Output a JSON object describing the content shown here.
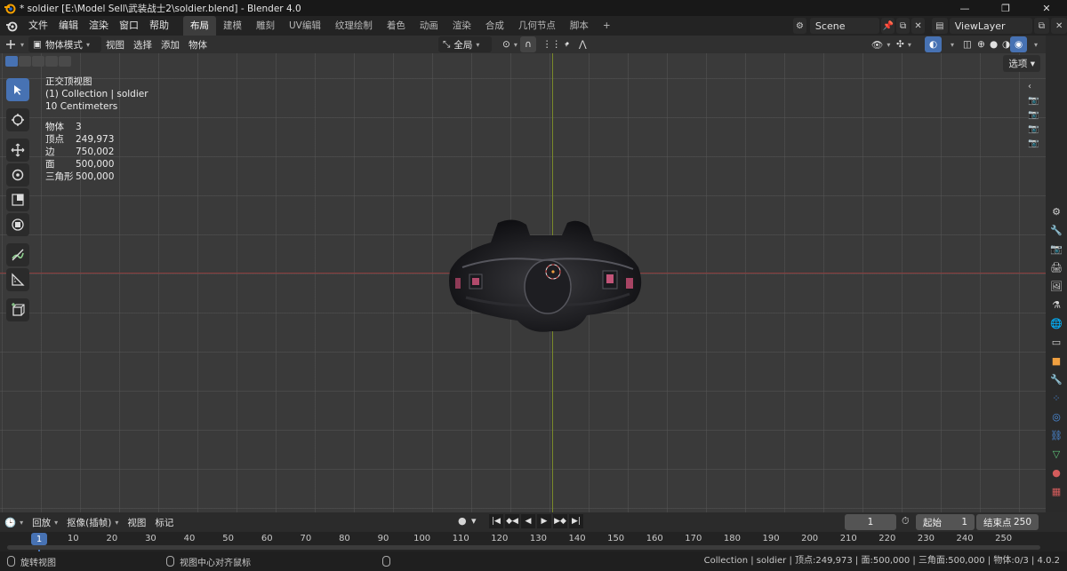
{
  "window": {
    "title": "* soldier [E:\\Model Sell\\武装战士2\\soldier.blend] - Blender 4.0",
    "controls": [
      "—",
      "❐",
      "✕"
    ]
  },
  "menu": [
    "文件",
    "编辑",
    "渲染",
    "窗口",
    "帮助"
  ],
  "workspaces": [
    {
      "label": "布局",
      "active": true
    },
    {
      "label": "建模",
      "active": false
    },
    {
      "label": "雕刻",
      "active": false
    },
    {
      "label": "UV编辑",
      "active": false
    },
    {
      "label": "纹理绘制",
      "active": false
    },
    {
      "label": "着色",
      "active": false
    },
    {
      "label": "动画",
      "active": false
    },
    {
      "label": "渲染",
      "active": false
    },
    {
      "label": "合成",
      "active": false
    },
    {
      "label": "几何节点",
      "active": false
    },
    {
      "label": "脚本",
      "active": false
    }
  ],
  "add_workspace": "+",
  "scene": {
    "name": "Scene"
  },
  "view_layer": {
    "name": "ViewLayer"
  },
  "viewport_header": {
    "mode": "物体模式",
    "menus": [
      "视图",
      "选择",
      "添加",
      "物体"
    ],
    "transform_orientation": "全局",
    "options": "选项"
  },
  "overlay": {
    "view_name": "正交顶视图",
    "collection": "(1) Collection | soldier",
    "grid_scale": "10 Centimeters"
  },
  "stats": [
    {
      "label": "物体",
      "value": "3"
    },
    {
      "label": "顶点",
      "value": "249,973"
    },
    {
      "label": "边",
      "value": "750,002"
    },
    {
      "label": "面",
      "value": "500,000"
    },
    {
      "label": "三角形",
      "value": "500,000"
    }
  ],
  "timeline": {
    "menus": [
      "回放",
      "抠像(插帧)",
      "视图",
      "标记"
    ],
    "current_frame": "1",
    "start_label": "起始",
    "start": "1",
    "end_label": "结束点",
    "end": "250",
    "ruler_ticks": [
      "10",
      "20",
      "30",
      "40",
      "50",
      "60",
      "70",
      "80",
      "90",
      "100",
      "110",
      "120",
      "130",
      "140",
      "150",
      "160",
      "170",
      "180",
      "190",
      "200",
      "210",
      "220",
      "230",
      "240",
      "250"
    ],
    "current_marker": "1"
  },
  "statusbar": {
    "left_hint_1": "旋转视图",
    "left_hint_2": "视图中心对齐鼠标",
    "right": "Collection | soldier | 顶点:249,973 | 面:500,000 | 三角面:500,000 | 物体:0/3 | 4.0.2"
  },
  "colors": {
    "accent": "#4772b3",
    "axis_x": "#8a3b3b",
    "axis_y": "#7a8a2a",
    "viewport_bg": "#3a3a3a"
  }
}
